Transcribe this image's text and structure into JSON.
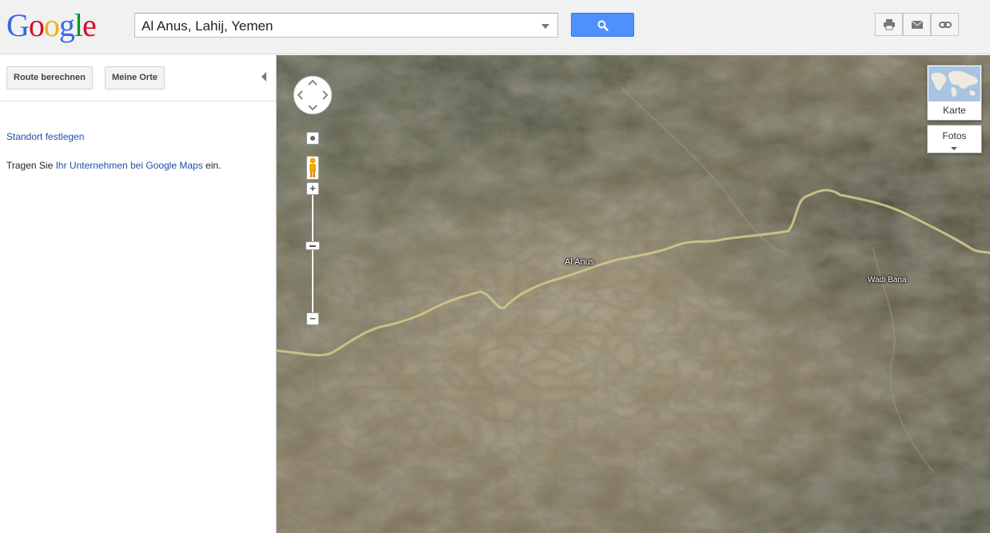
{
  "header": {
    "logo_letters": [
      {
        "ch": "G",
        "color": "#3369e8"
      },
      {
        "ch": "o",
        "color": "#d50f25"
      },
      {
        "ch": "o",
        "color": "#eeb211"
      },
      {
        "ch": "g",
        "color": "#3369e8"
      },
      {
        "ch": "l",
        "color": "#009925"
      },
      {
        "ch": "e",
        "color": "#d50f25"
      }
    ],
    "search_value": "Al Anus, Lahij, Yemen",
    "search_button_icon": "search-icon",
    "tools": [
      "print-icon",
      "mail-icon",
      "link-icon"
    ]
  },
  "panel": {
    "route_button": "Route berechnen",
    "places_button": "Meine Orte",
    "locate_link": "Standort festlegen",
    "business_prefix": "Tragen Sie ",
    "business_link": "Ihr Unternehmen bei Google Maps",
    "business_suffix": " ein."
  },
  "map": {
    "labels": {
      "town": "Al Anus",
      "wadi": "Wadi Bana"
    },
    "map_type": {
      "karte": "Karte",
      "fotos": "Fotos"
    },
    "zoom_level_fraction": 0.6
  }
}
